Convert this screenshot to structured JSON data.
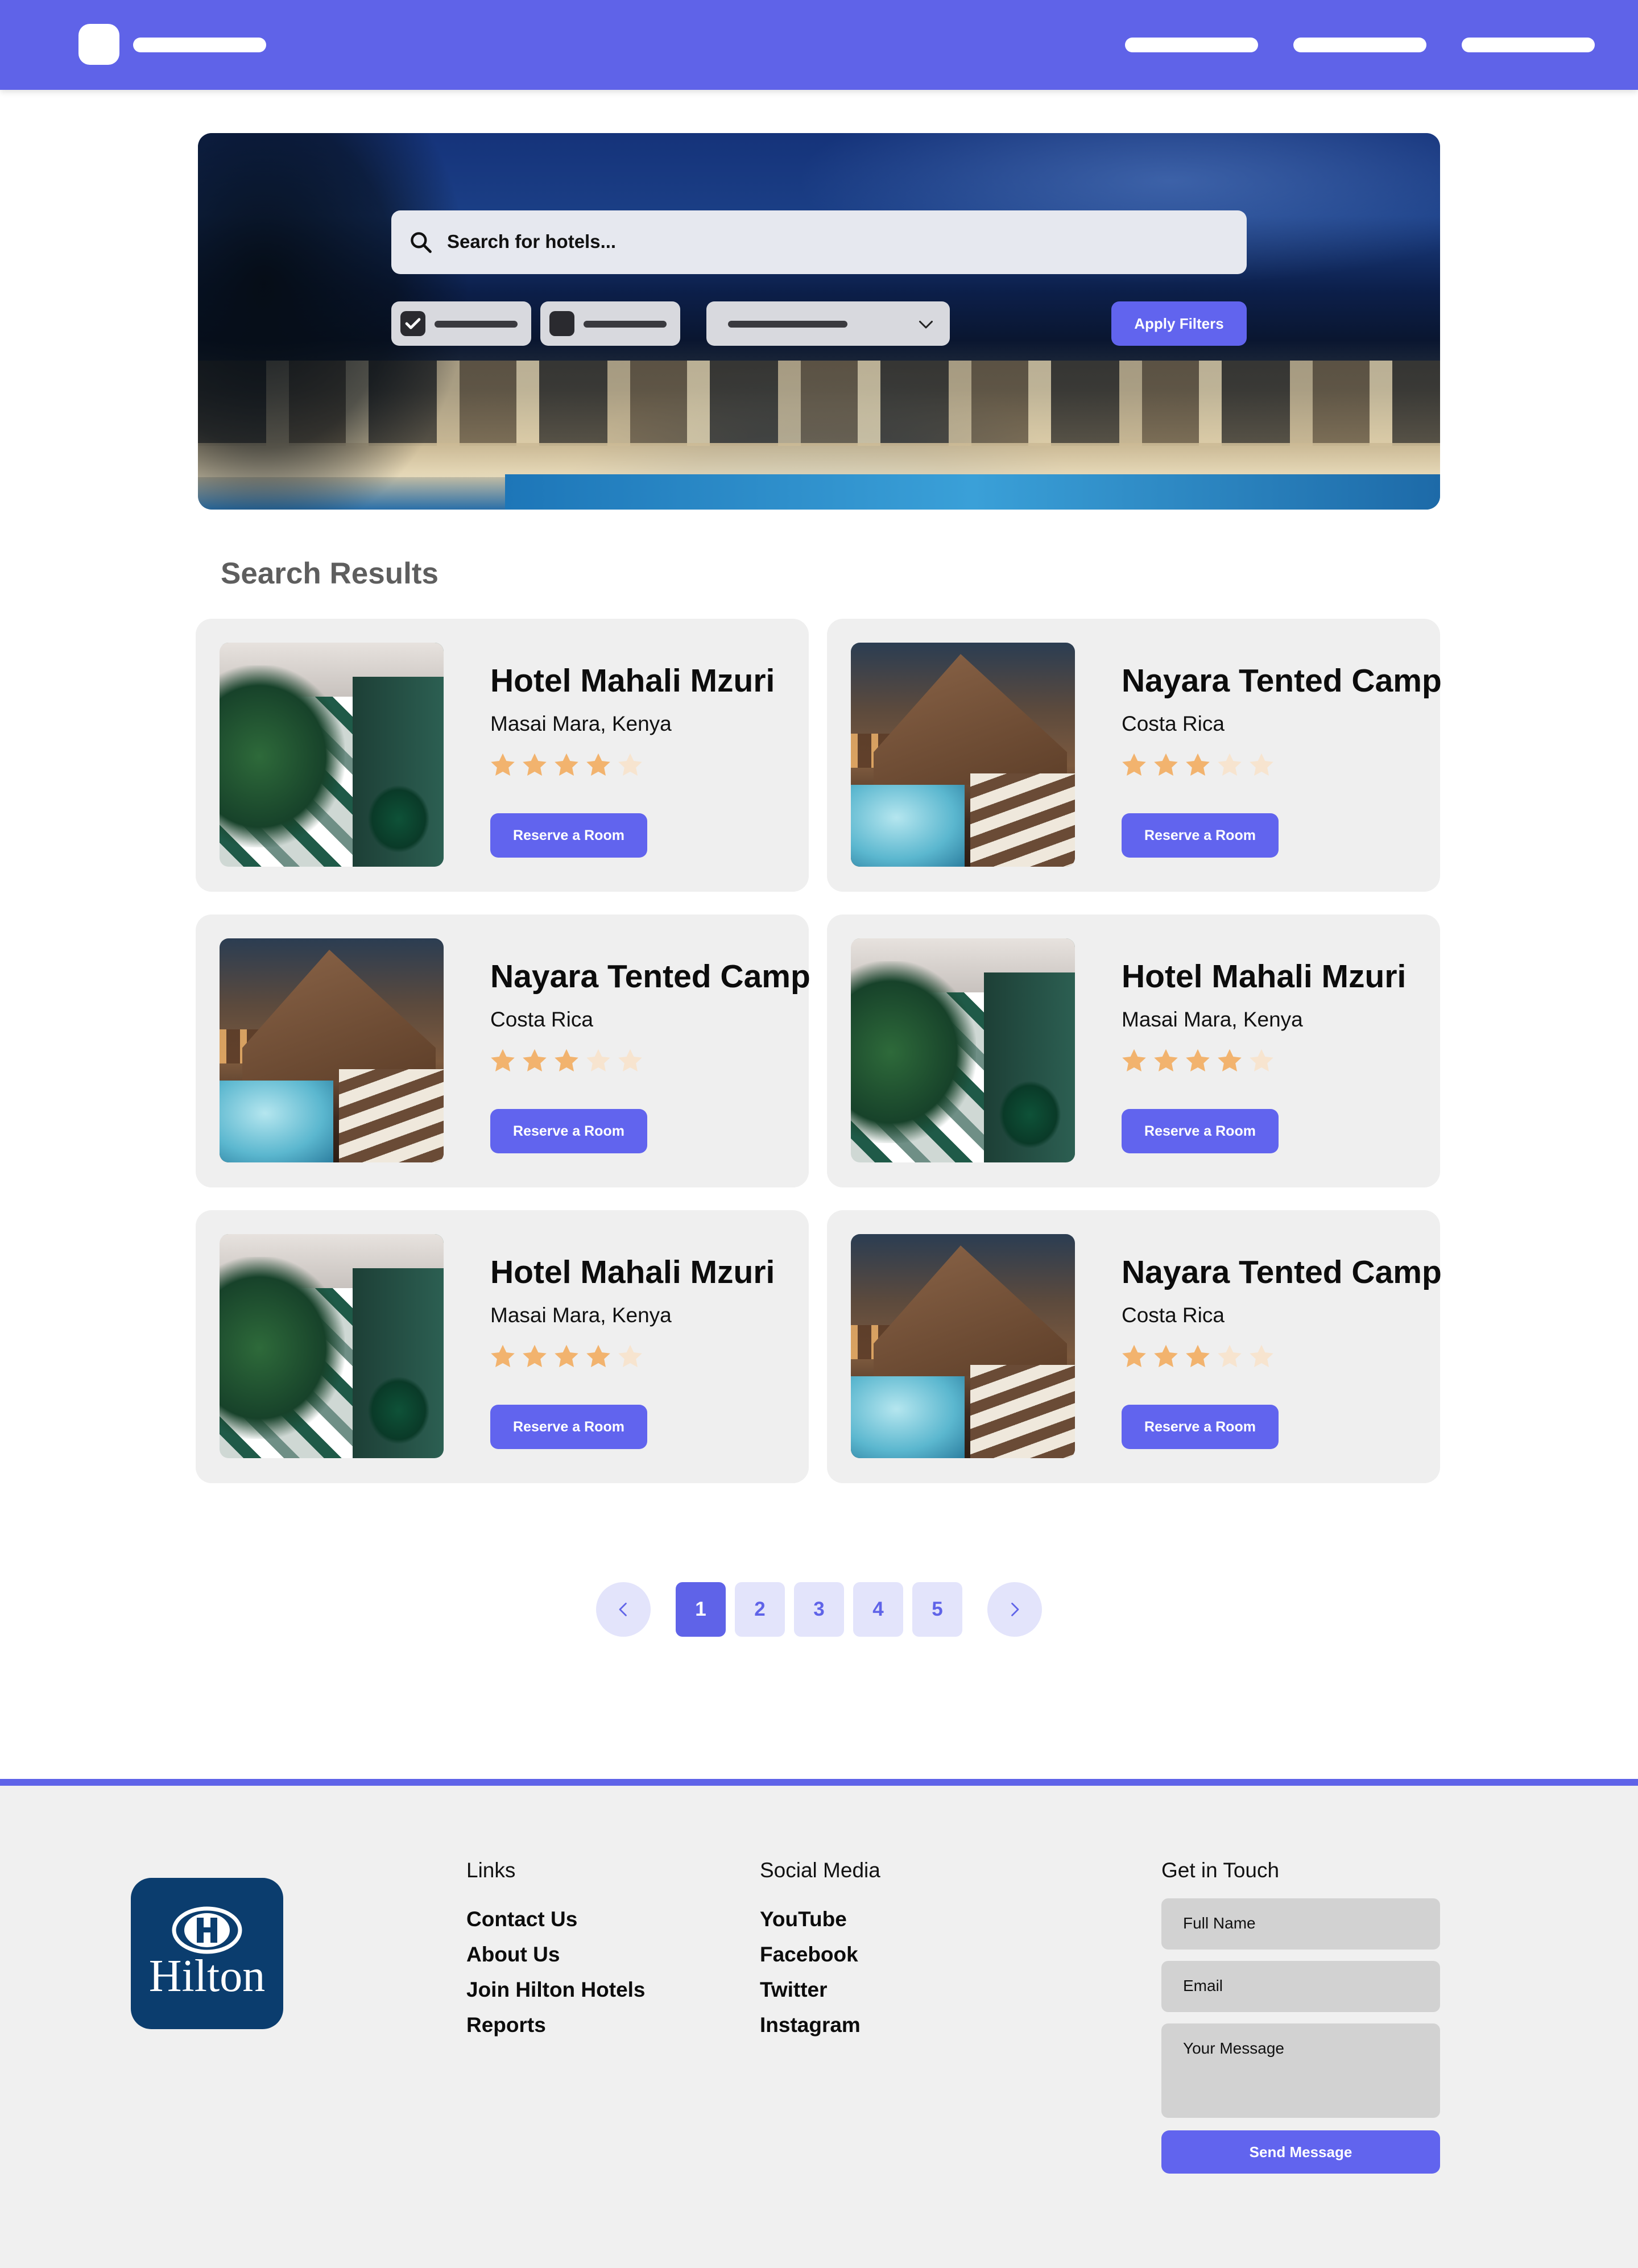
{
  "hero": {
    "search_placeholder": "Search for hotels...",
    "apply_label": "Apply Filters"
  },
  "results": {
    "title": "Search Results",
    "reserve_label": "Reserve a Room",
    "cards": [
      {
        "name": "Hotel Mahali Mzuri",
        "location": "Masai Mara, Kenya",
        "rating": 4,
        "max_rating": 5,
        "image": "courtyard-pool-image"
      },
      {
        "name": "Nayara Tented Camp",
        "location": "Costa Rica",
        "rating": 3,
        "max_rating": 5,
        "image": "lodge-pool-image"
      },
      {
        "name": "Nayara Tented Camp",
        "location": "Costa Rica",
        "rating": 3,
        "max_rating": 5,
        "image": "lodge-pool-image"
      },
      {
        "name": "Hotel Mahali Mzuri",
        "location": "Masai Mara, Kenya",
        "rating": 4,
        "max_rating": 5,
        "image": "courtyard-pool-image"
      },
      {
        "name": "Hotel Mahali Mzuri",
        "location": "Masai Mara, Kenya",
        "rating": 4,
        "max_rating": 5,
        "image": "courtyard-pool-image"
      },
      {
        "name": "Nayara Tented Camp",
        "location": "Costa Rica",
        "rating": 3,
        "max_rating": 5,
        "image": "lodge-pool-image"
      }
    ]
  },
  "pagination": {
    "pages": [
      "1",
      "2",
      "3",
      "4",
      "5"
    ],
    "current": "1",
    "prev_icon": "chevron-left-icon",
    "next_icon": "chevron-right-icon"
  },
  "footer": {
    "logo_text": "Hilton",
    "links_heading": "Links",
    "links": [
      "Contact Us",
      "About Us",
      "Join Hilton Hotels",
      "Reports"
    ],
    "social_heading": "Social Media",
    "social": [
      "YouTube",
      "Facebook",
      "Twitter",
      "Instagram"
    ],
    "contact_heading": "Get in Touch",
    "full_name_placeholder": "Full Name",
    "email_placeholder": "Email",
    "message_placeholder": "Your Message",
    "send_label": "Send Message"
  },
  "colors": {
    "accent": "#5f63e8",
    "button": "#6164ee",
    "star_filled": "#f2b36e",
    "star_empty": "#f7e4cf",
    "card_bg": "#efefef",
    "footer_bg": "#f0f0f0",
    "hilton_blue": "#0b3d6e"
  }
}
